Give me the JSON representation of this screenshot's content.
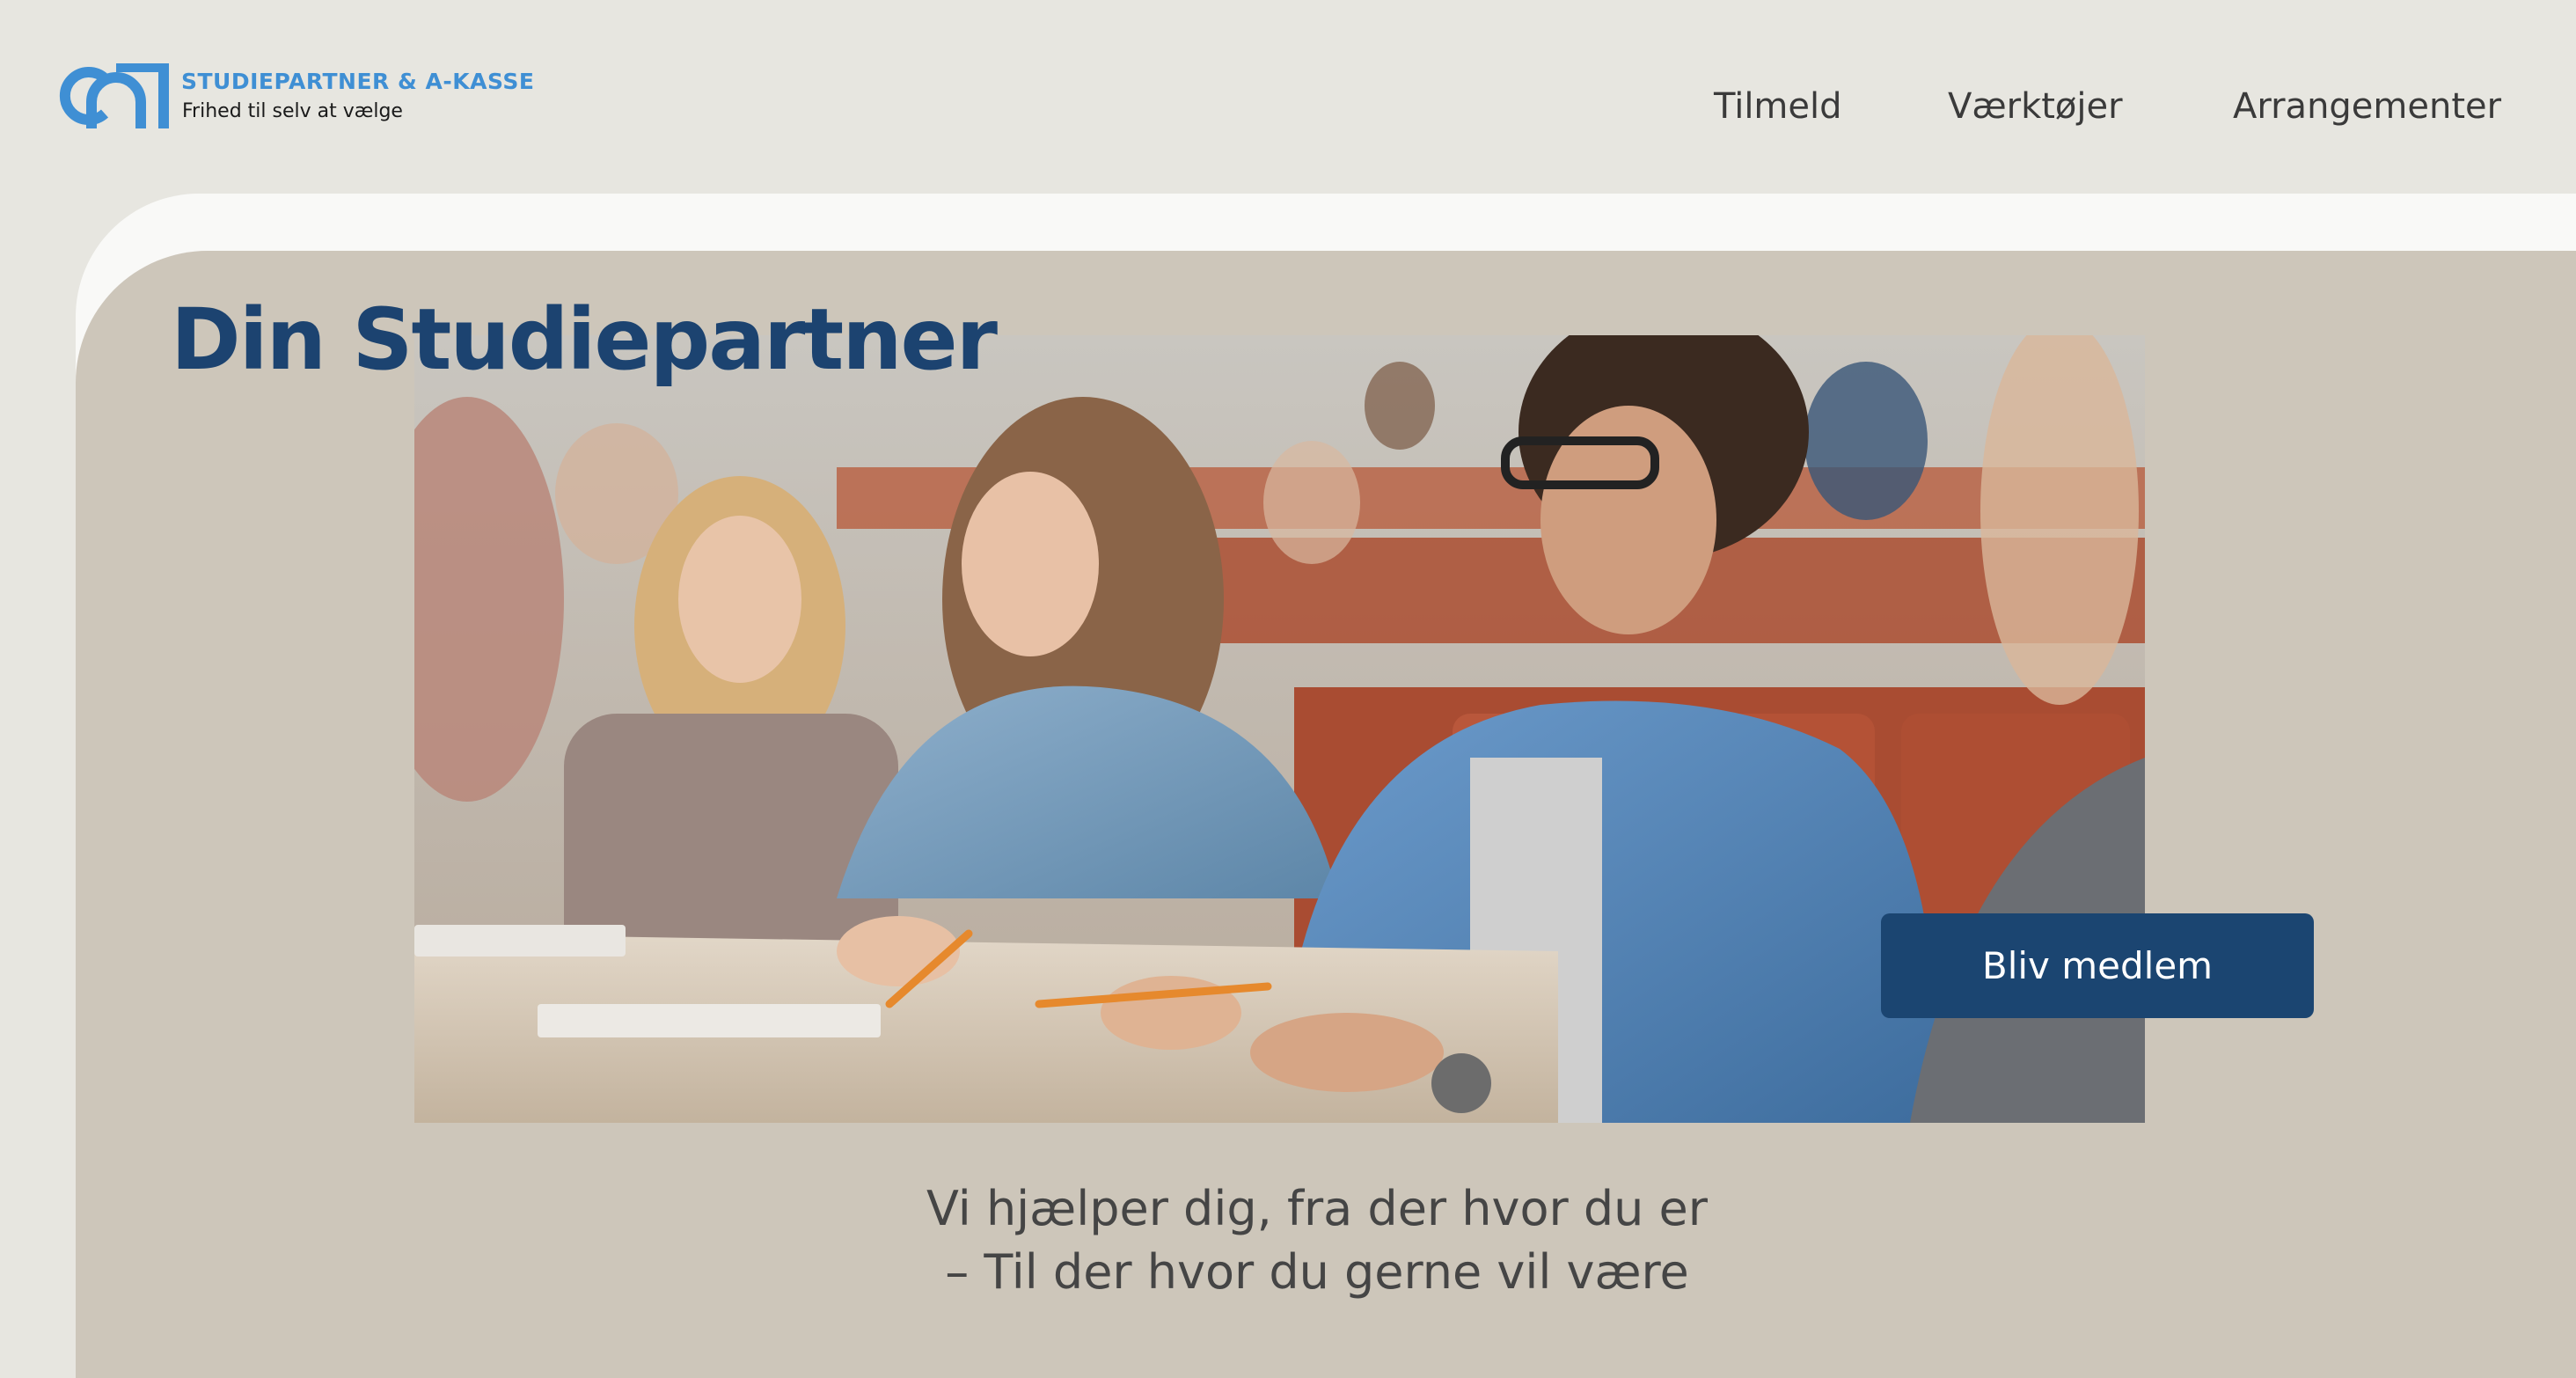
{
  "brand": {
    "name": "STUDIEPARTNER & A-KASSE",
    "tagline": "Frihed til selv at vælge",
    "logo_icon": "ca-logo-icon",
    "color": "#3f8fd4"
  },
  "nav": {
    "items": [
      {
        "label": "Tilmeld"
      },
      {
        "label": "Værktøjer"
      },
      {
        "label": "Arrangementer"
      }
    ]
  },
  "hero": {
    "title": "Din Studiepartner",
    "cta_label": "Bliv medlem",
    "photo_icon": "students-lecture-hall-photo",
    "subtitle_line1": "Vi hjælper dig, fra der hvor du er",
    "subtitle_line2": "– Til der hvor du gerne vil være"
  },
  "colors": {
    "background": "#e7e6e0",
    "panel": "#cdc6ba",
    "panel_highlight": "#f9f9f7",
    "primary_dark": "#1b4571",
    "title": "#1c4370"
  }
}
